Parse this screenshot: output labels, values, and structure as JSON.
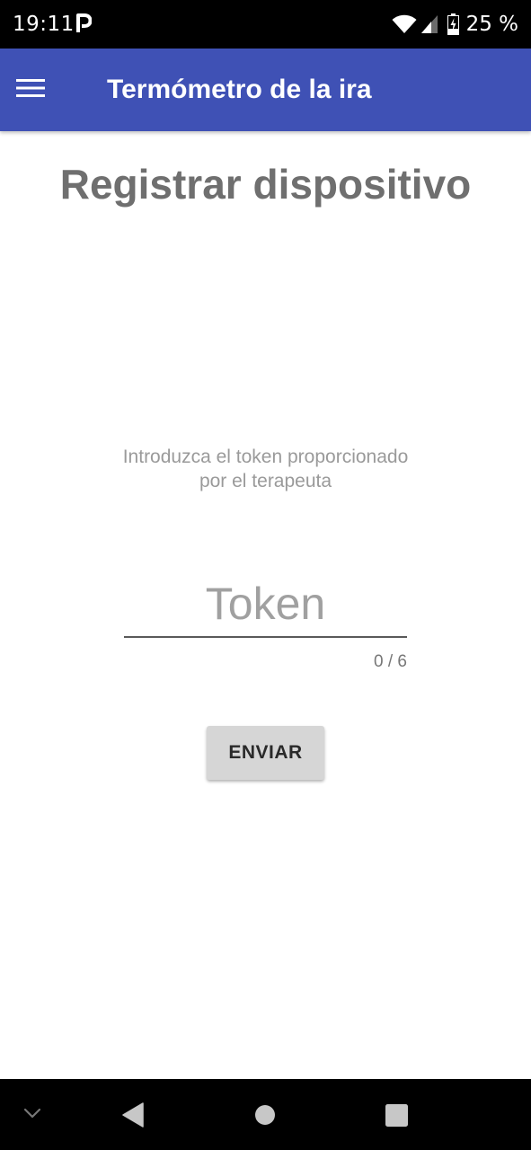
{
  "status_bar": {
    "time": "19:11",
    "battery": "25 %",
    "icons": [
      "parking-app-icon",
      "wifi-icon",
      "cellular-signal-icon",
      "battery-charging-icon"
    ]
  },
  "app_bar": {
    "title": "Termómetro de la ira",
    "menu_icon": "hamburger-menu-icon",
    "color": "#3f51b5"
  },
  "main": {
    "heading": "Registrar dispositivo",
    "instructions_line1": "Introduzca el token proporcionado",
    "instructions_line2": "por el terapeuta",
    "token_input": {
      "placeholder": "Token",
      "value": "",
      "counter": "0 / 6"
    },
    "send_button": "ENVIAR"
  },
  "nav_bar": {
    "icons": [
      "chevron-down-icon",
      "back-icon",
      "home-icon",
      "recents-icon"
    ]
  }
}
